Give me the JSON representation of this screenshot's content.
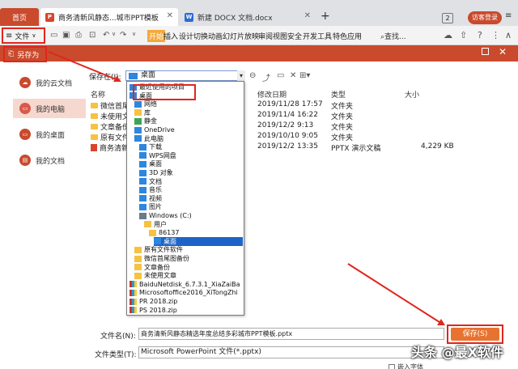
{
  "tabs": {
    "home": "首页",
    "ppt": "商务清新风静态...城市PPT模板",
    "docx": "新建 DOCX 文档.docx",
    "count": "2",
    "user": "访客登录"
  },
  "toolbar": {
    "file": "文件",
    "ribbon": [
      "开始",
      "插入",
      "设计",
      "切换",
      "动画",
      "幻灯片放映",
      "审阅",
      "视图",
      "安全",
      "开发工具",
      "特色应用"
    ],
    "search": "查找..."
  },
  "dialog": {
    "title": "另存为",
    "sidebar": [
      "我的云文档",
      "我的电脑",
      "我的桌面",
      "我的文档"
    ],
    "save_in_label": "保存在(I):",
    "location": "桌面",
    "columns": [
      "名称",
      "修改日期",
      "类型",
      "大小"
    ],
    "rows": [
      {
        "name": "微信首尾图备份",
        "date": "2019/11/28 17:57",
        "type": "文件夹",
        "size": "",
        "kind": "folder"
      },
      {
        "name": "未使用文章",
        "date": "2019/11/4 16:22",
        "type": "文件夹",
        "size": "",
        "kind": "folder"
      },
      {
        "name": "文章备份",
        "date": "2019/12/2 9:13",
        "type": "文件夹",
        "size": "",
        "kind": "folder"
      },
      {
        "name": "原有文件软件",
        "date": "2019/10/10 9:05",
        "type": "文件夹",
        "size": "",
        "kind": "folder"
      },
      {
        "name": "商务清新风静态",
        "date": "2019/12/2 13:35",
        "type": "PPTX 演示文稿",
        "size": "4,229 KB",
        "kind": "ppt"
      }
    ],
    "dropdown": [
      {
        "label": "最近使用的项目",
        "icon": "i-blue",
        "indent": 0
      },
      {
        "label": "桌面",
        "icon": "i-blue",
        "indent": 0,
        "selected": false
      },
      {
        "label": "网络",
        "icon": "i-blue",
        "indent": 1
      },
      {
        "label": "库",
        "icon": "i-fold",
        "indent": 1
      },
      {
        "label": "静金",
        "icon": "i-green",
        "indent": 1
      },
      {
        "label": "OneDrive",
        "icon": "i-blue",
        "indent": 1
      },
      {
        "label": "此电脑",
        "icon": "i-blue",
        "indent": 1
      },
      {
        "label": "下载",
        "icon": "i-blue",
        "indent": 2
      },
      {
        "label": "WPS网盘",
        "icon": "i-blue",
        "indent": 2
      },
      {
        "label": "桌面",
        "icon": "i-blue",
        "indent": 2
      },
      {
        "label": "3D 对象",
        "icon": "i-blue",
        "indent": 2
      },
      {
        "label": "文档",
        "icon": "i-blue",
        "indent": 2
      },
      {
        "label": "音乐",
        "icon": "i-blue",
        "indent": 2
      },
      {
        "label": "视频",
        "icon": "i-blue",
        "indent": 2
      },
      {
        "label": "图片",
        "icon": "i-blue",
        "indent": 2
      },
      {
        "label": "Windows (C:)",
        "icon": "i-disk",
        "indent": 2
      },
      {
        "label": "用户",
        "icon": "i-fold",
        "indent": 3
      },
      {
        "label": "86137",
        "icon": "i-fold",
        "indent": 4
      },
      {
        "label": "桌面",
        "icon": "i-blue",
        "indent": 5,
        "selected": true
      },
      {
        "label": "原有文件软件",
        "icon": "i-fold",
        "indent": 1
      },
      {
        "label": "微信首尾图备份",
        "icon": "i-fold",
        "indent": 1
      },
      {
        "label": "文章备份",
        "icon": "i-fold",
        "indent": 1
      },
      {
        "label": "未使用文章",
        "icon": "i-fold",
        "indent": 1
      },
      {
        "label": "BaiduNetdisk_6.7.3.1_XiaZaiBa",
        "icon": "i-zip",
        "indent": 0
      },
      {
        "label": "Microsoftoffice2016_XiTongZhi",
        "icon": "i-zip",
        "indent": 0
      },
      {
        "label": "PR 2018.zip",
        "icon": "i-zip",
        "indent": 0
      },
      {
        "label": "PS 2018.zip",
        "icon": "i-zip",
        "indent": 0
      }
    ],
    "filename_label": "文件名(N):",
    "filename": "商务清新风静态精选年度总结多彩城市PPT模板.pptx",
    "filetype_label": "文件类型(T):",
    "filetype": "Microsoft PowerPoint 文件(*.pptx)",
    "save_button": "保存(S)",
    "checkbox_label": "嵌入字体"
  },
  "watermark": "头条 @最X软件",
  "colors": {
    "accent": "#c94a2c",
    "annotation": "#e0261d",
    "save": "#e8722f"
  }
}
